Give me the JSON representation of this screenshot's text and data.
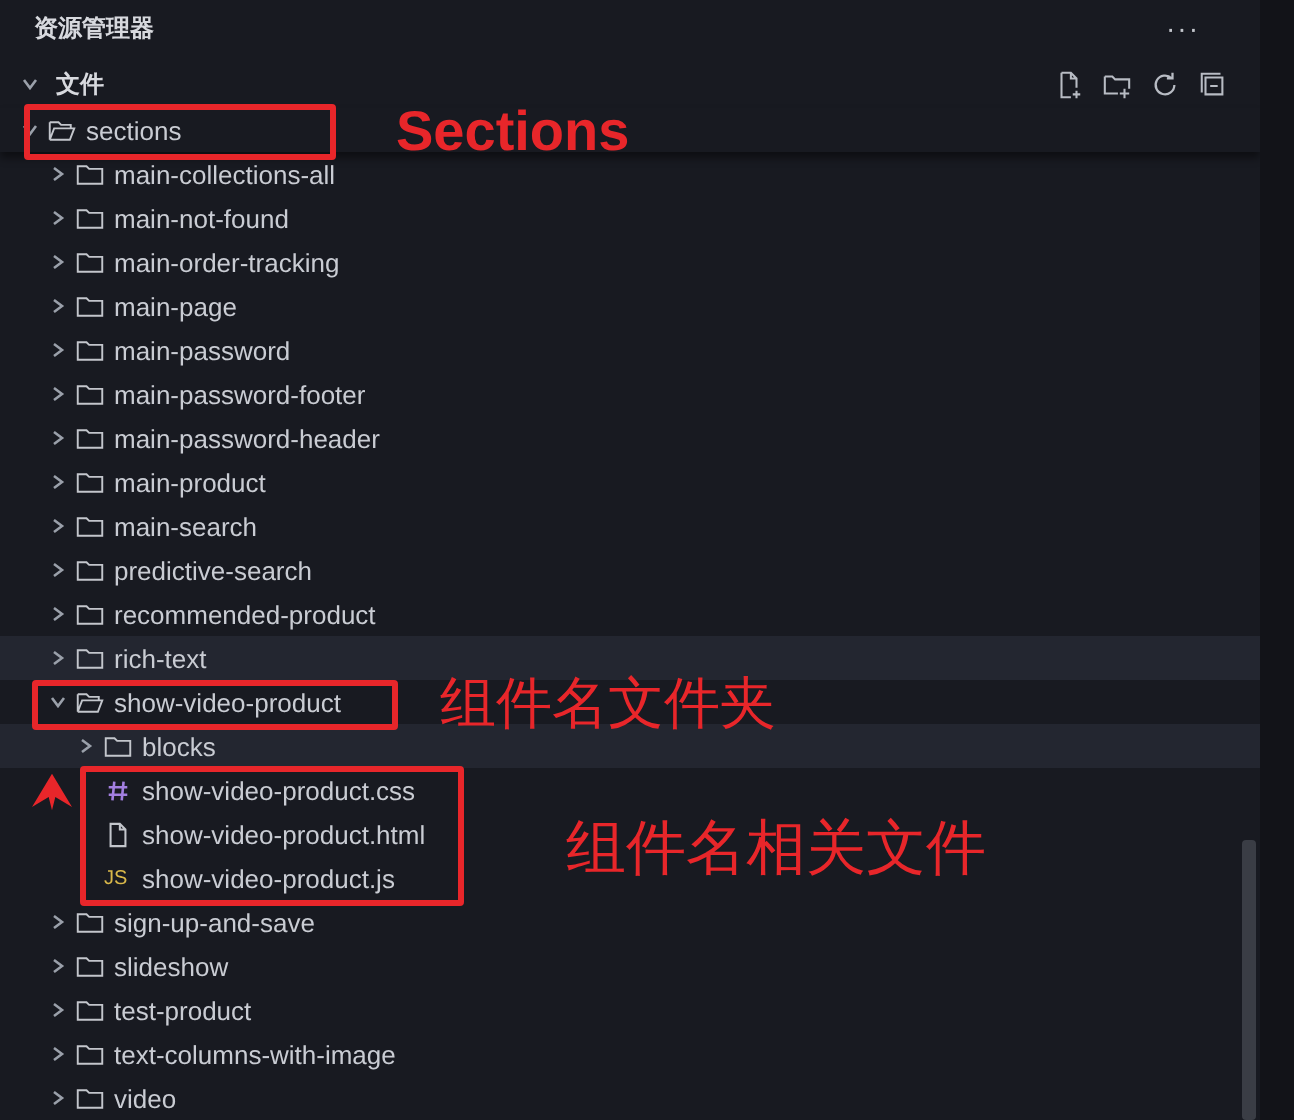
{
  "panel": {
    "title": "资源管理器",
    "more": "···"
  },
  "section": {
    "title": "文件",
    "expanded": true
  },
  "tree": [
    {
      "name": "sections",
      "kind": "folder",
      "expanded": true,
      "hovered": false,
      "children": [
        {
          "name": "main-collections-all",
          "kind": "folder",
          "expanded": false,
          "hovered": false
        },
        {
          "name": "main-not-found",
          "kind": "folder",
          "expanded": false,
          "hovered": false
        },
        {
          "name": "main-order-tracking",
          "kind": "folder",
          "expanded": false,
          "hovered": false
        },
        {
          "name": "main-page",
          "kind": "folder",
          "expanded": false,
          "hovered": false
        },
        {
          "name": "main-password",
          "kind": "folder",
          "expanded": false,
          "hovered": false
        },
        {
          "name": "main-password-footer",
          "kind": "folder",
          "expanded": false,
          "hovered": false
        },
        {
          "name": "main-password-header",
          "kind": "folder",
          "expanded": false,
          "hovered": false
        },
        {
          "name": "main-product",
          "kind": "folder",
          "expanded": false,
          "hovered": false
        },
        {
          "name": "main-search",
          "kind": "folder",
          "expanded": false,
          "hovered": false
        },
        {
          "name": "predictive-search",
          "kind": "folder",
          "expanded": false,
          "hovered": false
        },
        {
          "name": "recommended-product",
          "kind": "folder",
          "expanded": false,
          "hovered": false
        },
        {
          "name": "rich-text",
          "kind": "folder",
          "expanded": false,
          "hovered": true
        },
        {
          "name": "show-video-product",
          "kind": "folder",
          "expanded": true,
          "hovered": false,
          "children": [
            {
              "name": "blocks",
              "kind": "folder",
              "expanded": false,
              "hovered": true
            },
            {
              "name": "show-video-product.css",
              "kind": "css",
              "hovered": false
            },
            {
              "name": "show-video-product.html",
              "kind": "html",
              "hovered": false
            },
            {
              "name": "show-video-product.js",
              "kind": "js",
              "badge": "JS",
              "hovered": false
            }
          ]
        },
        {
          "name": "sign-up-and-save",
          "kind": "folder",
          "expanded": false,
          "hovered": false
        },
        {
          "name": "slideshow",
          "kind": "folder",
          "expanded": false,
          "hovered": false
        },
        {
          "name": "test-product",
          "kind": "folder",
          "expanded": false,
          "hovered": false
        },
        {
          "name": "text-columns-with-image",
          "kind": "folder",
          "expanded": false,
          "hovered": false
        },
        {
          "name": "video",
          "kind": "folder",
          "expanded": false,
          "hovered": false
        }
      ]
    }
  ],
  "annotations": [
    {
      "kind": "box"
    },
    {
      "kind": "box"
    },
    {
      "kind": "box"
    },
    {
      "kind": "arrow"
    },
    {
      "kind": "label",
      "text": "Sections"
    },
    {
      "kind": "label",
      "text": "组件名文件夹"
    },
    {
      "kind": "label",
      "text": "组件名相关文件"
    }
  ]
}
